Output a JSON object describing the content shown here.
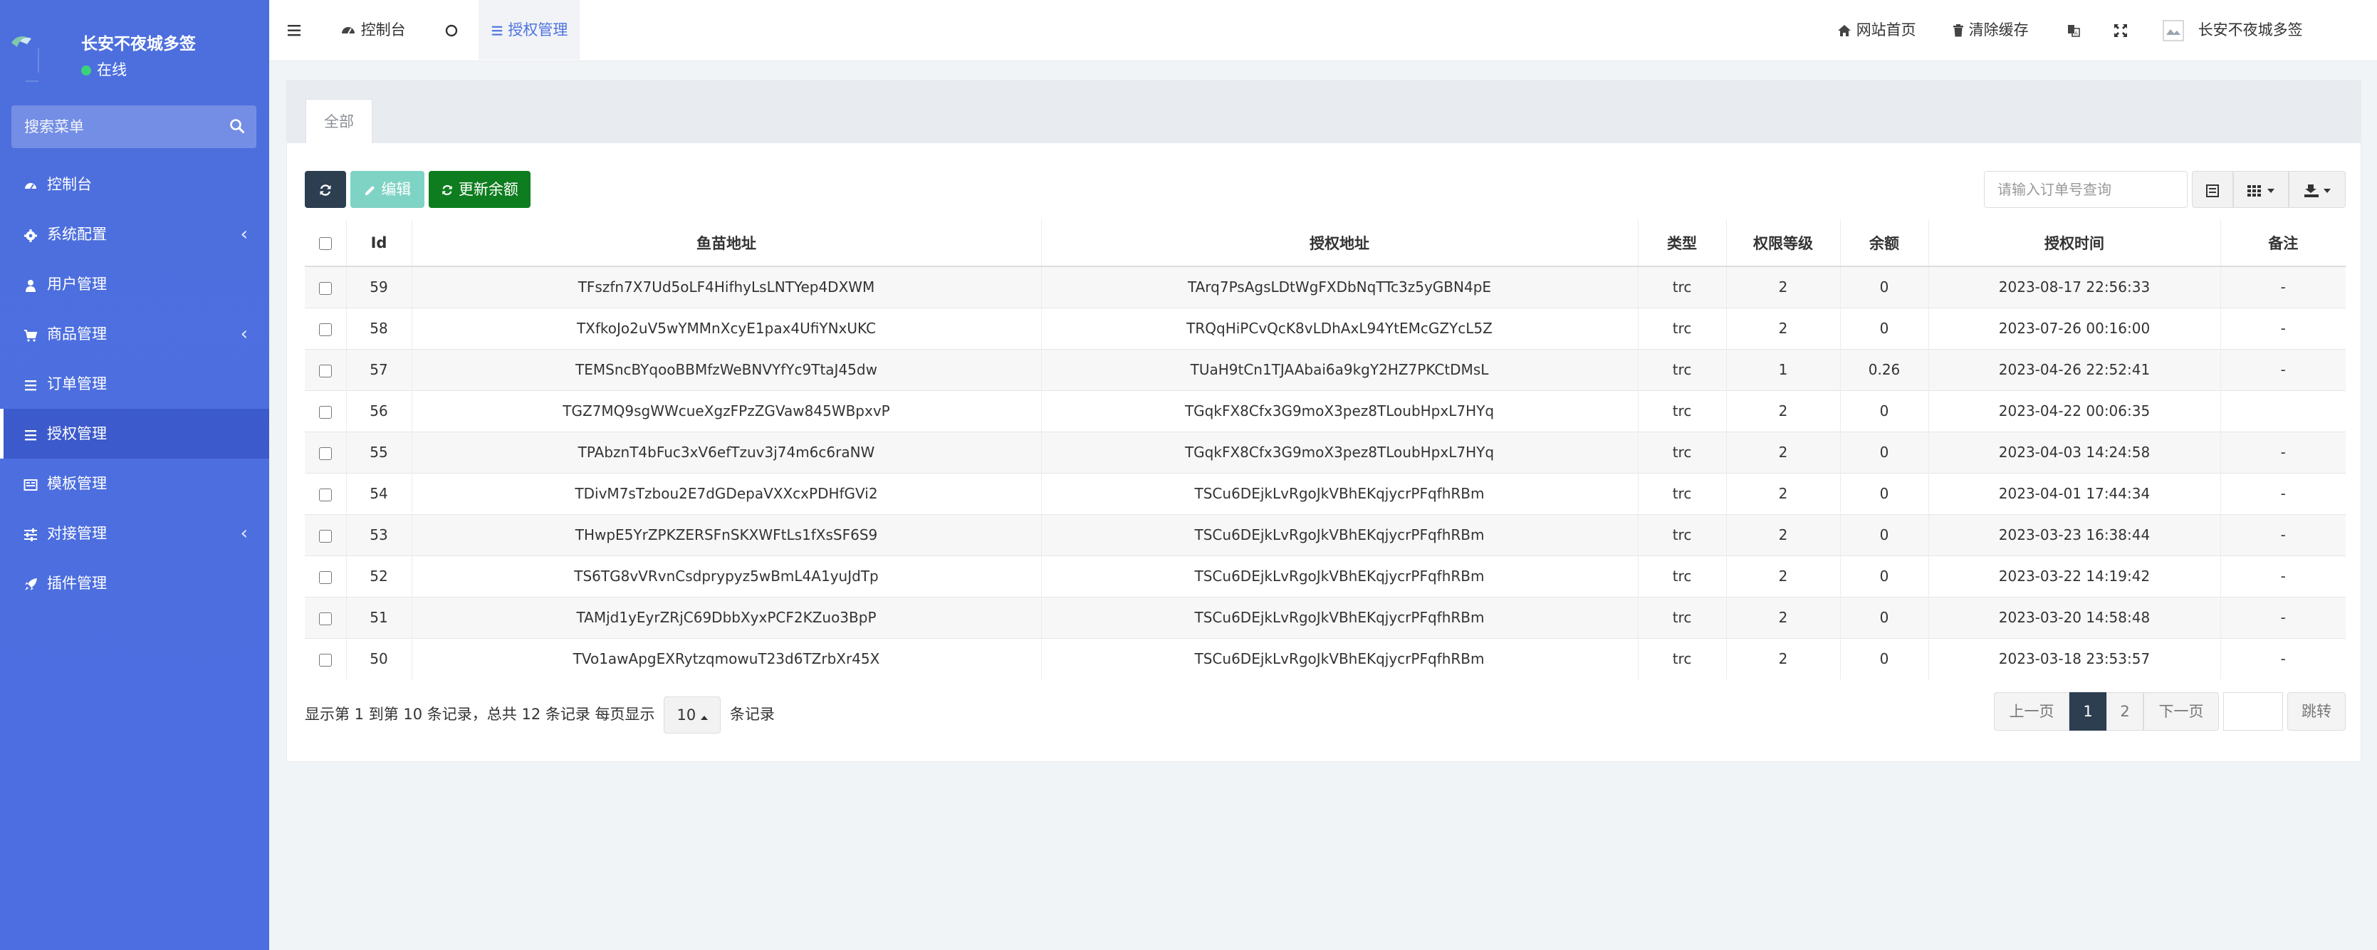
{
  "sidebar": {
    "user_name": "长安不夜城多签",
    "status": "在线",
    "search_placeholder": "搜索菜单",
    "items": [
      {
        "label": "控制台",
        "icon": "dashboard-icon"
      },
      {
        "label": "系统配置",
        "icon": "gear-icon"
      },
      {
        "label": "用户管理",
        "icon": "user-icon"
      },
      {
        "label": "商品管理",
        "icon": "cart-icon"
      },
      {
        "label": "订单管理",
        "icon": "list-icon"
      },
      {
        "label": "授权管理",
        "icon": "list-icon"
      },
      {
        "label": "模板管理",
        "icon": "template-icon"
      },
      {
        "label": "对接管理",
        "icon": "sliders-icon"
      },
      {
        "label": "插件管理",
        "icon": "rocket-icon"
      }
    ]
  },
  "header": {
    "tab_dashboard": "控制台",
    "tab_auth": "授权管理",
    "site_home": "网站首页",
    "clear_cache": "清除缓存",
    "user_name": "长安不夜城多签"
  },
  "panel": {
    "tab_all": "全部",
    "edit_label": "编辑",
    "update_balance_label": "更新余额",
    "search_placeholder": "请输入订单号查询"
  },
  "table": {
    "columns": [
      "Id",
      "鱼苗地址",
      "授权地址",
      "类型",
      "权限等级",
      "余额",
      "授权时间",
      "备注"
    ],
    "rows": [
      {
        "id": "59",
        "fish": "TFszfn7X7Ud5oLF4HifhyLsLNTYep4DXWM",
        "auth": "TArq7PsAgsLDtWgFXDbNqTTc3z5yGBN4pE",
        "type": "trc",
        "level": "2",
        "balance": "0",
        "time": "2023-08-17 22:56:33",
        "note": "-"
      },
      {
        "id": "58",
        "fish": "TXfkoJo2uV5wYMMnXcyE1pax4UfiYNxUKC",
        "auth": "TRQqHiPCvQcK8vLDhAxL94YtEMcGZYcL5Z",
        "type": "trc",
        "level": "2",
        "balance": "0",
        "time": "2023-07-26 00:16:00",
        "note": "-"
      },
      {
        "id": "57",
        "fish": "TEMSncBYqooBBMfzWeBNVYfYc9TtaJ45dw",
        "auth": "TUaH9tCn1TJAAbai6a9kgY2HZ7PKCtDMsL",
        "type": "trc",
        "level": "1",
        "balance": "0.26",
        "time": "2023-04-26 22:52:41",
        "note": "-"
      },
      {
        "id": "56",
        "fish": "TGZ7MQ9sgWWcueXgzFPzZGVaw845WBpxvP",
        "auth": "TGqkFX8Cfx3G9moX3pez8TLoubHpxL7HYq",
        "type": "trc",
        "level": "2",
        "balance": "0",
        "time": "2023-04-22 00:06:35",
        "note": ""
      },
      {
        "id": "55",
        "fish": "TPAbznT4bFuc3xV6efTzuv3j74m6c6raNW",
        "auth": "TGqkFX8Cfx3G9moX3pez8TLoubHpxL7HYq",
        "type": "trc",
        "level": "2",
        "balance": "0",
        "time": "2023-04-03 14:24:58",
        "note": "-"
      },
      {
        "id": "54",
        "fish": "TDivM7sTzbou2E7dGDepaVXXcxPDHfGVi2",
        "auth": "TSCu6DEjkLvRgoJkVBhEKqjycrPFqfhRBm",
        "type": "trc",
        "level": "2",
        "balance": "0",
        "time": "2023-04-01 17:44:34",
        "note": "-"
      },
      {
        "id": "53",
        "fish": "THwpE5YrZPKZERSFnSKXWFtLs1fXsSF6S9",
        "auth": "TSCu6DEjkLvRgoJkVBhEKqjycrPFqfhRBm",
        "type": "trc",
        "level": "2",
        "balance": "0",
        "time": "2023-03-23 16:38:44",
        "note": "-"
      },
      {
        "id": "52",
        "fish": "TS6TG8vVRvnCsdprypyz5wBmL4A1yuJdTp",
        "auth": "TSCu6DEjkLvRgoJkVBhEKqjycrPFqfhRBm",
        "type": "trc",
        "level": "2",
        "balance": "0",
        "time": "2023-03-22 14:19:42",
        "note": "-"
      },
      {
        "id": "51",
        "fish": "TAMjd1yEyrZRjC69DbbXyxPCF2KZuo3BpP",
        "auth": "TSCu6DEjkLvRgoJkVBhEKqjycrPFqfhRBm",
        "type": "trc",
        "level": "2",
        "balance": "0",
        "time": "2023-03-20 14:58:48",
        "note": "-"
      },
      {
        "id": "50",
        "fish": "TVo1awApgEXRytzqmowuT23d6TZrbXr45X",
        "auth": "TSCu6DEjkLvRgoJkVBhEKqjycrPFqfhRBm",
        "type": "trc",
        "level": "2",
        "balance": "0",
        "time": "2023-03-18 23:53:57",
        "note": "-"
      }
    ]
  },
  "footer": {
    "info_prefix": "显示第 1 到第 10 条记录，总共 12 条记录 每页显示",
    "page_size": "10",
    "info_suffix": "条记录",
    "prev": "上一页",
    "page1": "1",
    "page2": "2",
    "next": "下一页",
    "jump": "跳转"
  },
  "colors": {
    "sidebar": "#4e73df",
    "dark_button": "#2c3e50",
    "edit_button": "#7fd3c4",
    "balance_button": "#0e7d1f"
  }
}
